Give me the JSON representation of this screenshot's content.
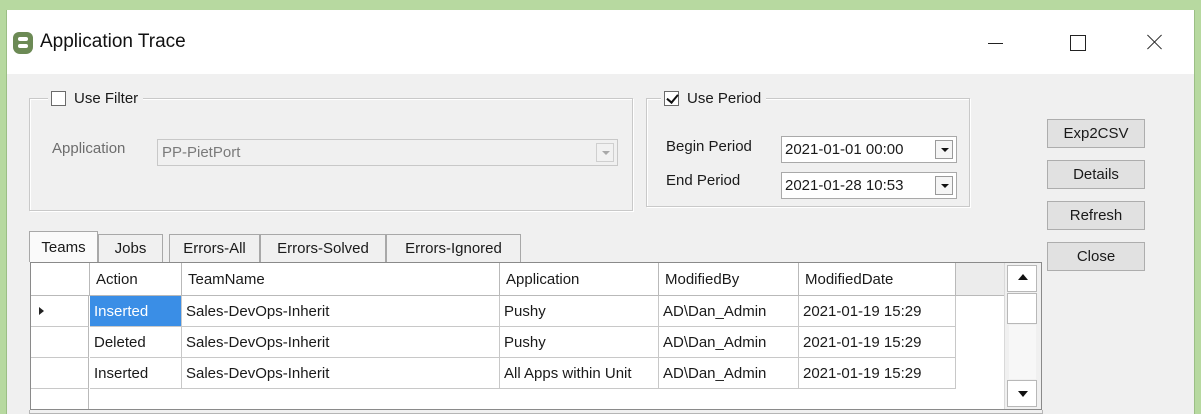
{
  "window": {
    "title": "Application Trace",
    "icon": "app-database-icon"
  },
  "filter": {
    "use_filter_label": "Use Filter",
    "use_filter_checked": false,
    "application_label": "Application",
    "application_value": "PP-PietPort"
  },
  "period": {
    "use_period_label": "Use Period",
    "use_period_checked": true,
    "begin_label": "Begin Period",
    "begin_value": "2021-01-01 00:00",
    "end_label": "End Period",
    "end_value": "2021-01-28 10:53"
  },
  "buttons": {
    "exp2csv": "Exp2CSV",
    "details": "Details",
    "refresh": "Refresh",
    "close": "Close"
  },
  "tabs": [
    {
      "label": "Teams",
      "active": true
    },
    {
      "label": "Jobs",
      "active": false
    },
    {
      "label": "Errors-All",
      "active": false
    },
    {
      "label": "Errors-Solved",
      "active": false
    },
    {
      "label": "Errors-Ignored",
      "active": false
    }
  ],
  "grid": {
    "columns": [
      "Action",
      "TeamName",
      "Application",
      "ModifiedBy",
      "ModifiedDate"
    ],
    "rows": [
      {
        "current": true,
        "cells": [
          "Inserted",
          "Sales-DevOps-Inherit",
          "Pushy",
          "AD\\Dan_Admin",
          "2021-01-19 15:29"
        ]
      },
      {
        "current": false,
        "cells": [
          "Deleted",
          "Sales-DevOps-Inherit",
          "Pushy",
          "AD\\Dan_Admin",
          "2021-01-19 15:29"
        ]
      },
      {
        "current": false,
        "cells": [
          "Inserted",
          "Sales-DevOps-Inherit",
          "All Apps within Unit",
          "AD\\Dan_Admin",
          "2021-01-19 15:29"
        ]
      }
    ]
  },
  "colors": {
    "selection": "#3a8ee6",
    "desktop": "#b7d9a0",
    "window_bg": "#f0f0f0"
  }
}
